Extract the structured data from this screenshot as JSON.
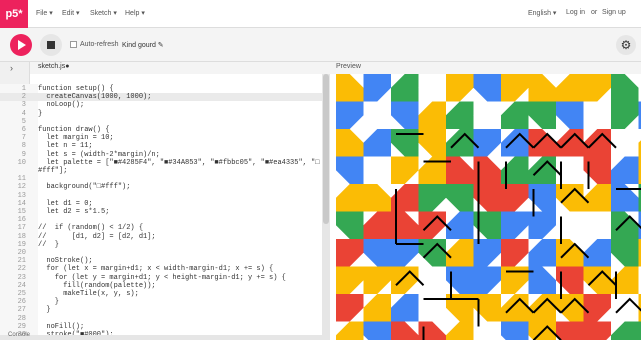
{
  "nav": {
    "logo": "p5*",
    "menu": [
      "File ▾",
      "Edit ▾",
      "Sketch ▾",
      "Help ▾"
    ],
    "language": "English ▾",
    "login": "Log in",
    "or": "or",
    "signup": "Sign up"
  },
  "toolbar": {
    "auto_refresh": "Auto-refresh",
    "sketch_name": "Kind gourd ✎"
  },
  "editor": {
    "file_tab": "sketch.js●",
    "lines": [
      {
        "n": "1",
        "code": "function setup() {"
      },
      {
        "n": "2",
        "code": "  createCanvas(1000, 1000);"
      },
      {
        "n": "3",
        "code": "  noLoop();"
      },
      {
        "n": "4",
        "code": "}"
      },
      {
        "n": "5",
        "code": ""
      },
      {
        "n": "6",
        "code": "function draw() {"
      },
      {
        "n": "7",
        "code": "  let margin = 10;"
      },
      {
        "n": "8",
        "code": "  let n = 11;"
      },
      {
        "n": "9",
        "code": "  let s = (width-2*margin)/n;"
      },
      {
        "n": "10",
        "code": "  let palette = [\"■#4285F4\", \"■#34A853\", \"■#fbbc05\", \"■#ea4335\", \"□"
      },
      {
        "n": "",
        "code": "#fff\"];"
      },
      {
        "n": "11",
        "code": ""
      },
      {
        "n": "12",
        "code": "  background(\"□#fff\");"
      },
      {
        "n": "13",
        "code": ""
      },
      {
        "n": "14",
        "code": "  let d1 = 0;"
      },
      {
        "n": "15",
        "code": "  let d2 = s*1.5;"
      },
      {
        "n": "16",
        "code": ""
      },
      {
        "n": "17",
        "code": "//  if (random() < 1/2) {"
      },
      {
        "n": "18",
        "code": "//      [d1, d2] = [d2, d1];"
      },
      {
        "n": "19",
        "code": "//  }"
      },
      {
        "n": "20",
        "code": ""
      },
      {
        "n": "21",
        "code": "  noStroke();"
      },
      {
        "n": "22",
        "code": "  for (let x = margin+d1; x < width-margin-d1; x += s) {"
      },
      {
        "n": "23",
        "code": "    for (let y = margin+d1; y < height-margin-d1; y += s) {"
      },
      {
        "n": "24",
        "code": "      fill(random(palette));"
      },
      {
        "n": "25",
        "code": "      makeTile(x, y, s);"
      },
      {
        "n": "26",
        "code": "    }"
      },
      {
        "n": "27",
        "code": "  }"
      },
      {
        "n": "28",
        "code": ""
      },
      {
        "n": "29",
        "code": "  noFill();"
      },
      {
        "n": "30",
        "code": "  stroke(\"■#000\");"
      }
    ]
  },
  "console_label": "Console",
  "preview_label": "Preview",
  "colors": {
    "blue": "#4285F4",
    "green": "#34A853",
    "yellow": "#fbbc05",
    "red": "#ea4335",
    "brand": "#ed225d"
  },
  "icons": [
    "play-icon",
    "stop-icon",
    "gear-icon",
    "chevron-right-icon",
    "pencil-icon"
  ]
}
